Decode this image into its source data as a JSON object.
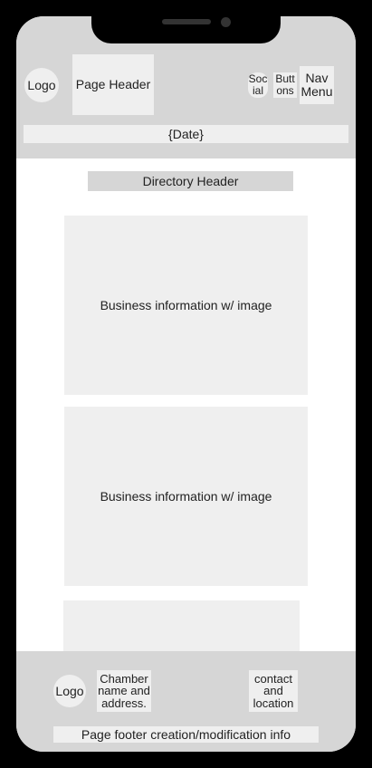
{
  "header": {
    "logo_label": "Logo",
    "page_header_label": "Page Header",
    "social_label": "Social",
    "buttons_label": "Buttons",
    "nav_menu_label": "Nav Menu",
    "date_label": "{Date}"
  },
  "main": {
    "directory_header": "Directory Header",
    "cards": [
      {
        "label": "Business information w/ image"
      },
      {
        "label": "Business information w/ image"
      },
      {
        "label": ""
      }
    ]
  },
  "footer": {
    "logo_label": "Logo",
    "chamber_label": "Chamber name and address.",
    "contact_label": "contact and location",
    "creation_info": "Page footer creation/modification info"
  }
}
